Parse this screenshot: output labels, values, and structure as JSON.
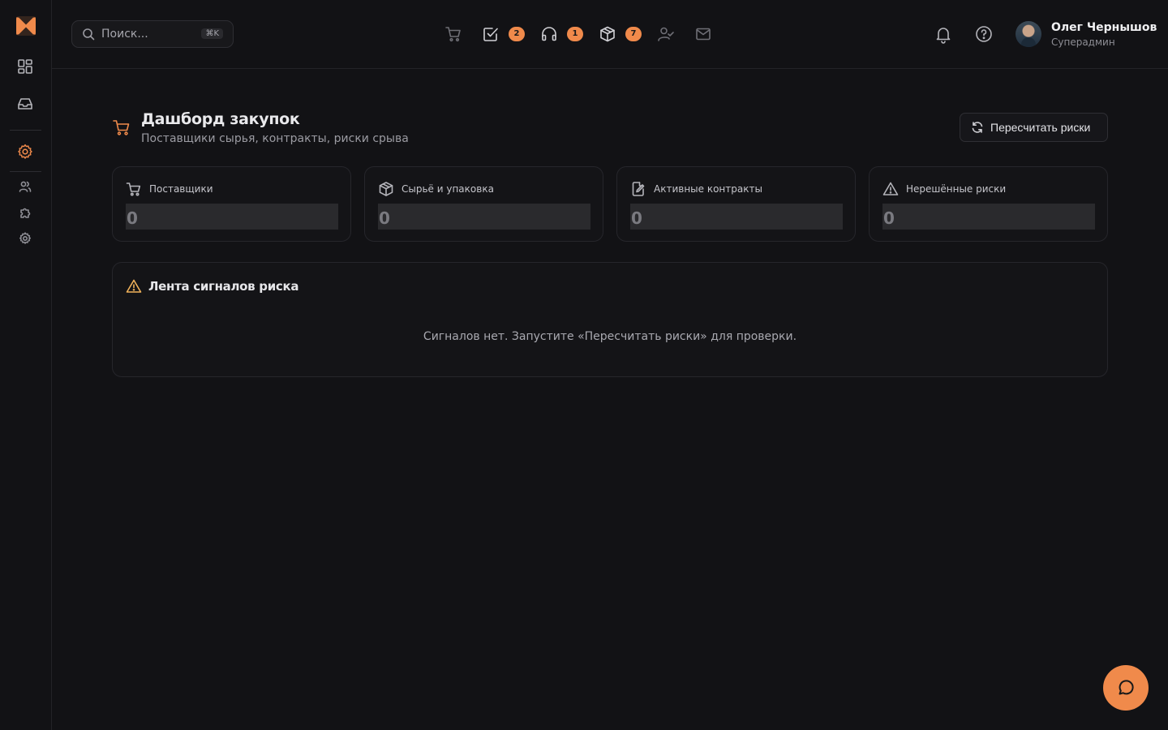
{
  "header": {
    "search": {
      "placeholder": "Поиск...",
      "shortcut": "⌘K"
    },
    "quick_icons": [
      {
        "icon": "cart-icon",
        "badge": null
      },
      {
        "icon": "checkbox-icon",
        "badge": "2"
      },
      {
        "icon": "headphones-icon",
        "badge": "1"
      },
      {
        "icon": "box-icon",
        "badge": "7"
      },
      {
        "icon": "user-check-icon",
        "badge": null
      },
      {
        "icon": "mail-icon",
        "badge": null
      }
    ],
    "user": {
      "name": "Олег Чернышов",
      "role": "Суперадмин"
    }
  },
  "page": {
    "title": "Дашборд закупок",
    "subtitle": "Поставщики сырья, контракты, риски срыва",
    "recalc_label": "Пересчитать риски"
  },
  "stats": [
    {
      "label": "Поставщики",
      "value": "0",
      "icon": "cart-icon"
    },
    {
      "label": "Сырьё и упаковка",
      "value": "0",
      "icon": "package-icon"
    },
    {
      "label": "Активные контракты",
      "value": "0",
      "icon": "contract-edit-icon"
    },
    {
      "label": "Нерешённые риски",
      "value": "0",
      "icon": "warning-icon"
    }
  ],
  "feed": {
    "title": "Лента сигналов риска",
    "empty_text": "Сигналов нет. Запустите «Пересчитать риски» для проверки."
  },
  "colors": {
    "accent": "#f08a4b",
    "warning": "#f0b25a",
    "background": "#121215"
  }
}
